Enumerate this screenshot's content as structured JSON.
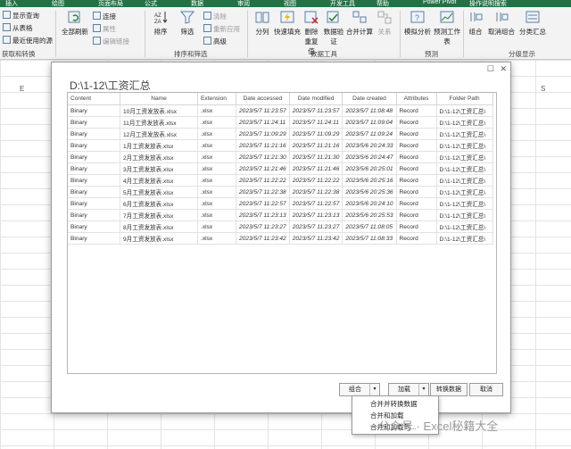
{
  "ribbon": {
    "tabs": [
      "插入",
      "绘图",
      "页面布局",
      "公式",
      "数据",
      "审阅",
      "视图",
      "开发工具",
      "帮助",
      "Power Pivot",
      "操作说明搜索"
    ],
    "get_transform": {
      "items": [
        "显示查询",
        "从表格",
        "最近使用的源"
      ],
      "label": "获取和转换"
    },
    "queries": {
      "refresh_all": "全部刷新",
      "items": [
        "连接",
        "属性",
        "编辑链接"
      ]
    },
    "sort_filter": {
      "sort": "排序",
      "filter": "筛选",
      "items": [
        "清除",
        "重新应用",
        "高级"
      ],
      "label": "排序和筛选"
    },
    "data_tools": {
      "items": [
        "分列",
        "快速填充",
        "删除重复值",
        "数据验证",
        "合并计算",
        "关系"
      ],
      "label": "数据工具"
    },
    "forecast": {
      "items": [
        "模拟分析",
        "预测工作表"
      ],
      "label": "预测"
    },
    "outline": {
      "items": [
        "组合",
        "取消组合",
        "分类汇总"
      ],
      "label": "分级显示"
    }
  },
  "sheet": {
    "col_e": "E",
    "col_s": "S"
  },
  "dialog": {
    "title": "D:\\1-12\\工资汇总",
    "columns": [
      "Content",
      "Name",
      "Extension",
      "Date accessed",
      "Date modified",
      "Date created",
      "Attributes",
      "Folder Path"
    ],
    "rows": [
      [
        "Binary",
        "10月工资发放表.xlsx",
        ".xlsx",
        "2023/5/7 11:23:57",
        "2023/5/7 11:23:57",
        "2023/5/7 11:08:48",
        "Record",
        "D:\\1-12\\工资汇总\\"
      ],
      [
        "Binary",
        "11月工资发放表.xlsx",
        ".xlsx",
        "2023/5/7 11:24:11",
        "2023/5/7 11:24:11",
        "2023/5/7 11:09:04",
        "Record",
        "D:\\1-12\\工资汇总\\"
      ],
      [
        "Binary",
        "12月工资发放表.xlsx",
        ".xlsx",
        "2023/5/7 11:09:29",
        "2023/5/7 11:09:29",
        "2023/5/7 11:09:24",
        "Record",
        "D:\\1-12\\工资汇总\\"
      ],
      [
        "Binary",
        "1月工资发放表.xlsx",
        ".xlsx",
        "2023/5/7 11:21:16",
        "2023/5/7 11:21:16",
        "2023/5/6 20:24:33",
        "Record",
        "D:\\1-12\\工资汇总\\"
      ],
      [
        "Binary",
        "2月工资发放表.xlsx",
        ".xlsx",
        "2023/5/7 11:21:30",
        "2023/5/7 11:21:30",
        "2023/5/6 20:24:47",
        "Record",
        "D:\\1-12\\工资汇总\\"
      ],
      [
        "Binary",
        "3月工资发放表.xlsx",
        ".xlsx",
        "2023/5/7 11:21:46",
        "2023/5/7 11:21:46",
        "2023/5/6 20:25:01",
        "Record",
        "D:\\1-12\\工资汇总\\"
      ],
      [
        "Binary",
        "4月工资发放表.xlsx",
        ".xlsx",
        "2023/5/7 11:22:22",
        "2023/5/7 11:22:22",
        "2023/5/6 20:25:16",
        "Record",
        "D:\\1-12\\工资汇总\\"
      ],
      [
        "Binary",
        "5月工资发放表.xlsx",
        ".xlsx",
        "2023/5/7 11:22:38",
        "2023/5/7 11:22:38",
        "2023/5/6 20:25:36",
        "Record",
        "D:\\1-12\\工资汇总\\"
      ],
      [
        "Binary",
        "6月工资发放表.xlsx",
        ".xlsx",
        "2023/5/7 11:22:57",
        "2023/5/7 11:22:57",
        "2023/5/6 20:24:10",
        "Record",
        "D:\\1-12\\工资汇总\\"
      ],
      [
        "Binary",
        "7月工资发放表.xlsx",
        ".xlsx",
        "2023/5/7 11:23:13",
        "2023/5/7 11:23:13",
        "2023/5/6 20:25:53",
        "Record",
        "D:\\1-12\\工资汇总\\"
      ],
      [
        "Binary",
        "8月工资发放表.xlsx",
        ".xlsx",
        "2023/5/7 11:23:27",
        "2023/5/7 11:23:27",
        "2023/5/7 11:08:05",
        "Record",
        "D:\\1-12\\工资汇总\\"
      ],
      [
        "Binary",
        "9月工资发放表.xlsx",
        ".xlsx",
        "2023/5/7 11:23:42",
        "2023/5/7 11:23:42",
        "2023/5/7 11:08:33",
        "Record",
        "D:\\1-12\\工资汇总\\"
      ]
    ],
    "buttons": {
      "combine": "组合",
      "load": "加载",
      "transform": "转换数据",
      "cancel": "取消"
    },
    "menu": [
      "合并并转换数据",
      "合并和加载",
      "合并和加载到..."
    ]
  },
  "watermark": "公众号 · Excel秘籍大全"
}
